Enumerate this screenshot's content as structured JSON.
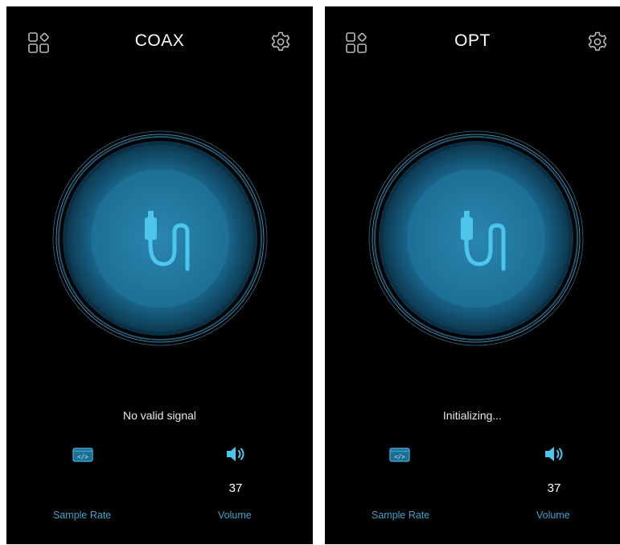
{
  "screens": [
    {
      "title": "COAX",
      "status": "No valid signal",
      "volume_value": "37",
      "sample_rate_label": "Sample Rate",
      "volume_label": "Volume"
    },
    {
      "title": "OPT",
      "status": "Initializing...",
      "volume_value": "37",
      "sample_rate_label": "Sample Rate",
      "volume_label": "Volume"
    }
  ],
  "icons": {
    "apps": "apps-grid-icon",
    "settings": "gear-icon",
    "input": "cable-plug-icon",
    "sample_rate": "code-window-icon",
    "volume": "speaker-icon"
  },
  "colors": {
    "background": "#000000",
    "accent": "#3fc1e6",
    "dial_inner": "#1d6f94",
    "label": "#3aa3cc",
    "icon_gray": "#b9b9b9"
  }
}
